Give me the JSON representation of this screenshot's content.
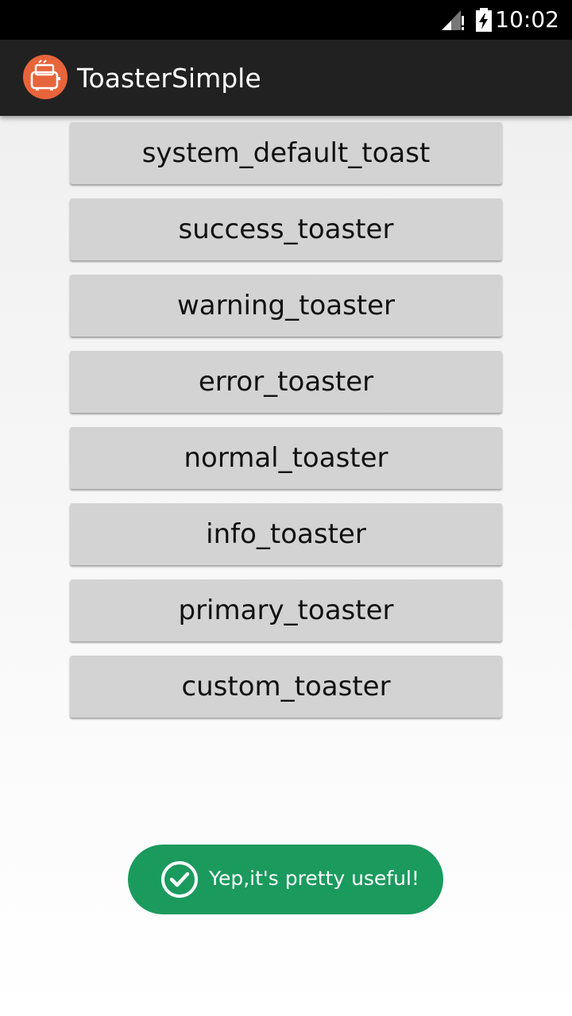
{
  "status_bar": {
    "time": "10:02"
  },
  "app_bar": {
    "title": "ToasterSimple"
  },
  "buttons": [
    {
      "label": "system_default_toast"
    },
    {
      "label": "success_toaster"
    },
    {
      "label": "warning_toaster"
    },
    {
      "label": "error_toaster"
    },
    {
      "label": "normal_toaster"
    },
    {
      "label": "info_toaster"
    },
    {
      "label": "primary_toaster"
    },
    {
      "label": "custom_toaster"
    }
  ],
  "toast": {
    "message": "Yep,it's pretty useful!"
  },
  "colors": {
    "app_icon_bg": "#e8643a",
    "toast_bg": "#1b9a5e",
    "button_bg": "#d3d3d3",
    "app_bar_bg": "#212121"
  },
  "icons": {
    "app": "toaster-icon",
    "signal": "signal-icon",
    "battery": "battery-charging-icon",
    "toast": "check-circle-icon"
  }
}
